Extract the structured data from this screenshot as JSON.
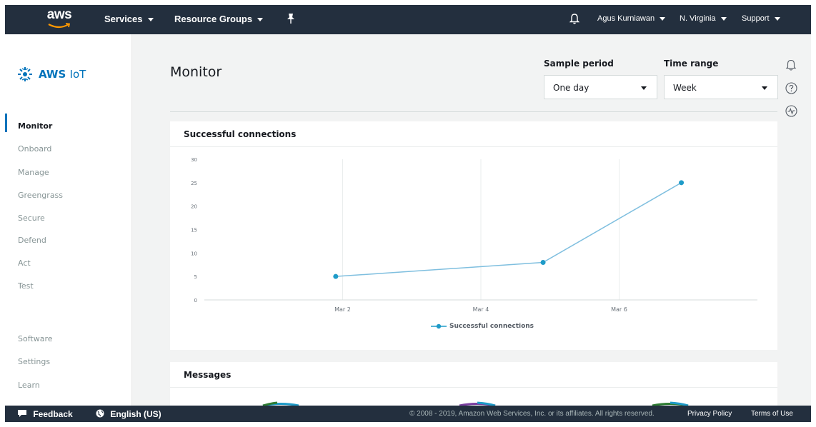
{
  "topnav": {
    "logo_text": "aws",
    "services": "Services",
    "resource_groups": "Resource Groups",
    "user": "Agus Kurniawan",
    "region": "N. Virginia",
    "support": "Support"
  },
  "sidebar": {
    "brand_bold": "AWS",
    "brand_light": "IoT",
    "items": [
      {
        "label": "Monitor",
        "active": true
      },
      {
        "label": "Onboard"
      },
      {
        "label": "Manage"
      },
      {
        "label": "Greengrass"
      },
      {
        "label": "Secure"
      },
      {
        "label": "Defend"
      },
      {
        "label": "Act"
      },
      {
        "label": "Test"
      }
    ],
    "bottom_items": [
      {
        "label": "Software"
      },
      {
        "label": "Settings"
      },
      {
        "label": "Learn"
      }
    ]
  },
  "main": {
    "title": "Monitor",
    "sample_period": {
      "label": "Sample period",
      "value": "One day"
    },
    "time_range": {
      "label": "Time range",
      "value": "Week"
    }
  },
  "connections_card": {
    "title": "Successful connections"
  },
  "messages_card": {
    "title": "Messages"
  },
  "chart_data": {
    "type": "line",
    "title": "Successful connections",
    "x_tick_labels": [
      "Mar 2",
      "Mar 4",
      "Mar 6"
    ],
    "ylim": [
      0,
      30
    ],
    "y_ticks": [
      0,
      5,
      10,
      15,
      20,
      25,
      30
    ],
    "grid": "vertical",
    "legend_position": "bottom-center",
    "color": "#1f9bc8",
    "series": [
      {
        "name": "Successful connections",
        "points": [
          {
            "x": "Mar 1.9",
            "x_value": 1.9,
            "y": 5
          },
          {
            "x": "Mar 4.9",
            "x_value": 4.9,
            "y": 8
          },
          {
            "x": "Mar 6.9",
            "x_value": 6.9,
            "y": 25
          }
        ]
      }
    ]
  },
  "footer": {
    "feedback": "Feedback",
    "language": "English (US)",
    "copyright": "© 2008 - 2019, Amazon Web Services, Inc. or its affiliates. All rights reserved.",
    "privacy": "Privacy Policy",
    "terms": "Terms of Use"
  },
  "icons": {
    "top_pin": "pin-icon",
    "top_bell": "bell-icon",
    "right": [
      "bell-icon",
      "help-icon",
      "activity-icon"
    ]
  }
}
